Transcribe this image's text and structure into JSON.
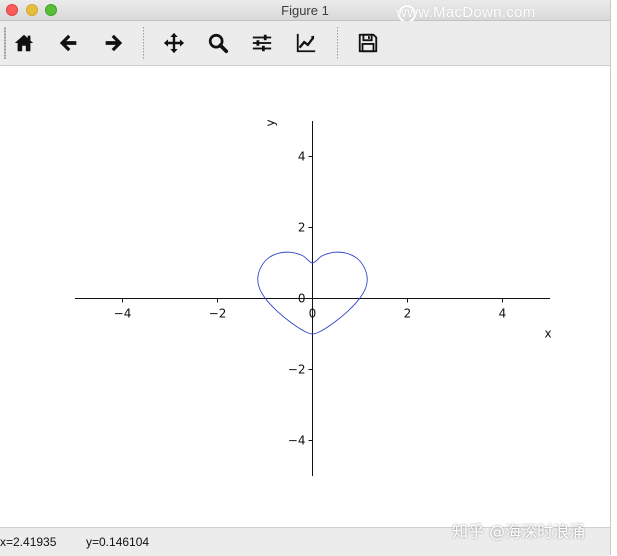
{
  "window": {
    "title": "Figure 1"
  },
  "watermarks": {
    "top": "www.MacDown.com",
    "bottom": "知乎 @海深时浪涌"
  },
  "toolbar": {
    "tools": [
      {
        "name": "home-button",
        "icon": "home-icon"
      },
      {
        "name": "back-button",
        "icon": "arrow-left-icon"
      },
      {
        "name": "forward-button",
        "icon": "arrow-right-icon"
      },
      {
        "name": "pan-button",
        "icon": "move-icon"
      },
      {
        "name": "zoom-button",
        "icon": "magnifier-icon"
      },
      {
        "name": "subplots-button",
        "icon": "sliders-icon"
      },
      {
        "name": "edit-axis-button",
        "icon": "line-chart-icon"
      },
      {
        "name": "save-button",
        "icon": "floppy-disk-icon"
      }
    ]
  },
  "status": {
    "x_readout": "x=2.41935",
    "y_readout": "y=0.146104"
  },
  "chart_data": {
    "type": "line",
    "title": "",
    "xlabel": "x",
    "ylabel": "y",
    "xlim": [
      -5,
      5
    ],
    "ylim": [
      -5,
      5
    ],
    "xticks": [
      -4,
      -2,
      0,
      2,
      4
    ],
    "yticks": [
      -4,
      -2,
      0,
      2,
      4
    ],
    "xtick_labels": [
      "−4",
      "−2",
      "0",
      "2",
      "4"
    ],
    "ytick_labels": [
      "−4",
      "−2",
      "0",
      "2",
      "4"
    ],
    "grid": false,
    "spines": "centered",
    "series": [
      {
        "color": "#3344cc",
        "closed": true,
        "points": [
          [
            0.0,
            1.0
          ],
          [
            0.2,
            1.2
          ],
          [
            0.45,
            1.3
          ],
          [
            0.7,
            1.28
          ],
          [
            0.92,
            1.15
          ],
          [
            1.07,
            0.92
          ],
          [
            1.15,
            0.6
          ],
          [
            1.12,
            0.3
          ],
          [
            0.98,
            -0.02
          ],
          [
            0.75,
            -0.35
          ],
          [
            0.45,
            -0.68
          ],
          [
            0.2,
            -0.9
          ],
          [
            0.0,
            -1.0
          ],
          [
            -0.2,
            -0.9
          ],
          [
            -0.45,
            -0.68
          ],
          [
            -0.75,
            -0.35
          ],
          [
            -0.98,
            -0.02
          ],
          [
            -1.12,
            0.3
          ],
          [
            -1.15,
            0.6
          ],
          [
            -1.07,
            0.92
          ],
          [
            -0.92,
            1.15
          ],
          [
            -0.7,
            1.28
          ],
          [
            -0.45,
            1.3
          ],
          [
            -0.2,
            1.2
          ],
          [
            0.0,
            1.0
          ]
        ]
      }
    ]
  }
}
